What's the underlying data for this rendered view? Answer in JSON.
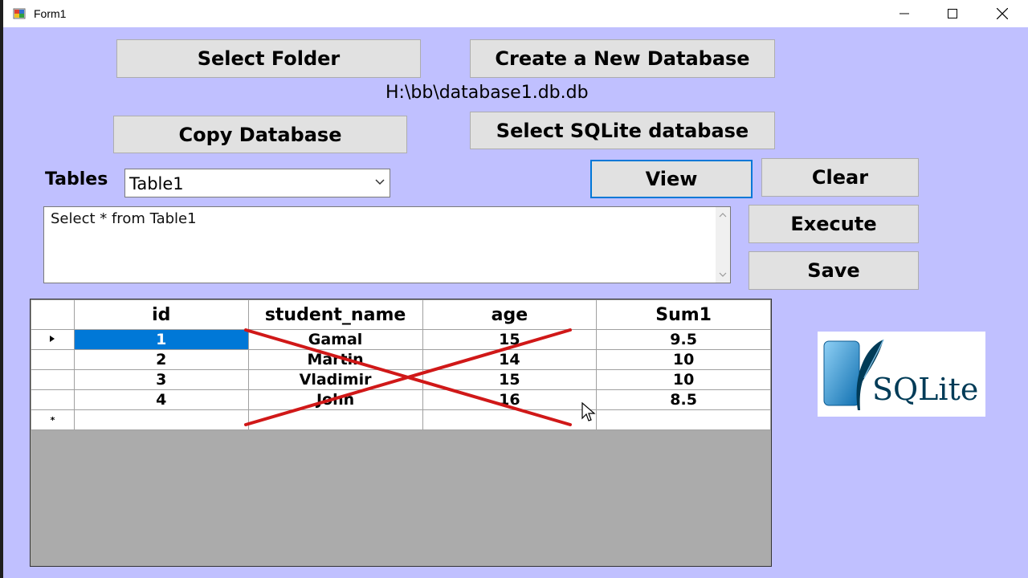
{
  "window": {
    "title": "Form1"
  },
  "buttons": {
    "select_folder": "Select Folder",
    "create_db": "Create a New Database",
    "copy_db": "Copy Database",
    "select_sqlite": "Select SQLite database",
    "view": "View",
    "clear": "Clear",
    "execute": "Execute",
    "save": "Save"
  },
  "path_label": "H:\\bb\\database1.db.db",
  "tables": {
    "label": "Tables",
    "selected": "Table1"
  },
  "query": {
    "text": "Select * from Table1"
  },
  "grid": {
    "columns": [
      "id",
      "student_name",
      "age",
      "Sum1"
    ],
    "rows": [
      [
        "1",
        "Gamal",
        "15",
        "9.5"
      ],
      [
        "2",
        "Martin",
        "14",
        "10"
      ],
      [
        "3",
        "Vladimir",
        "15",
        "10"
      ],
      [
        "4",
        "John",
        "16",
        "8.5"
      ]
    ],
    "selected_cell": "row-1-id",
    "new_row_marker": "*"
  },
  "logo": {
    "text": "SQLite",
    "icon": "feather-icon"
  },
  "colors": {
    "form_bg": "#c0c0ff",
    "selection": "#0078d7",
    "cross": "#d01818",
    "grid_bg": "#ababab"
  }
}
